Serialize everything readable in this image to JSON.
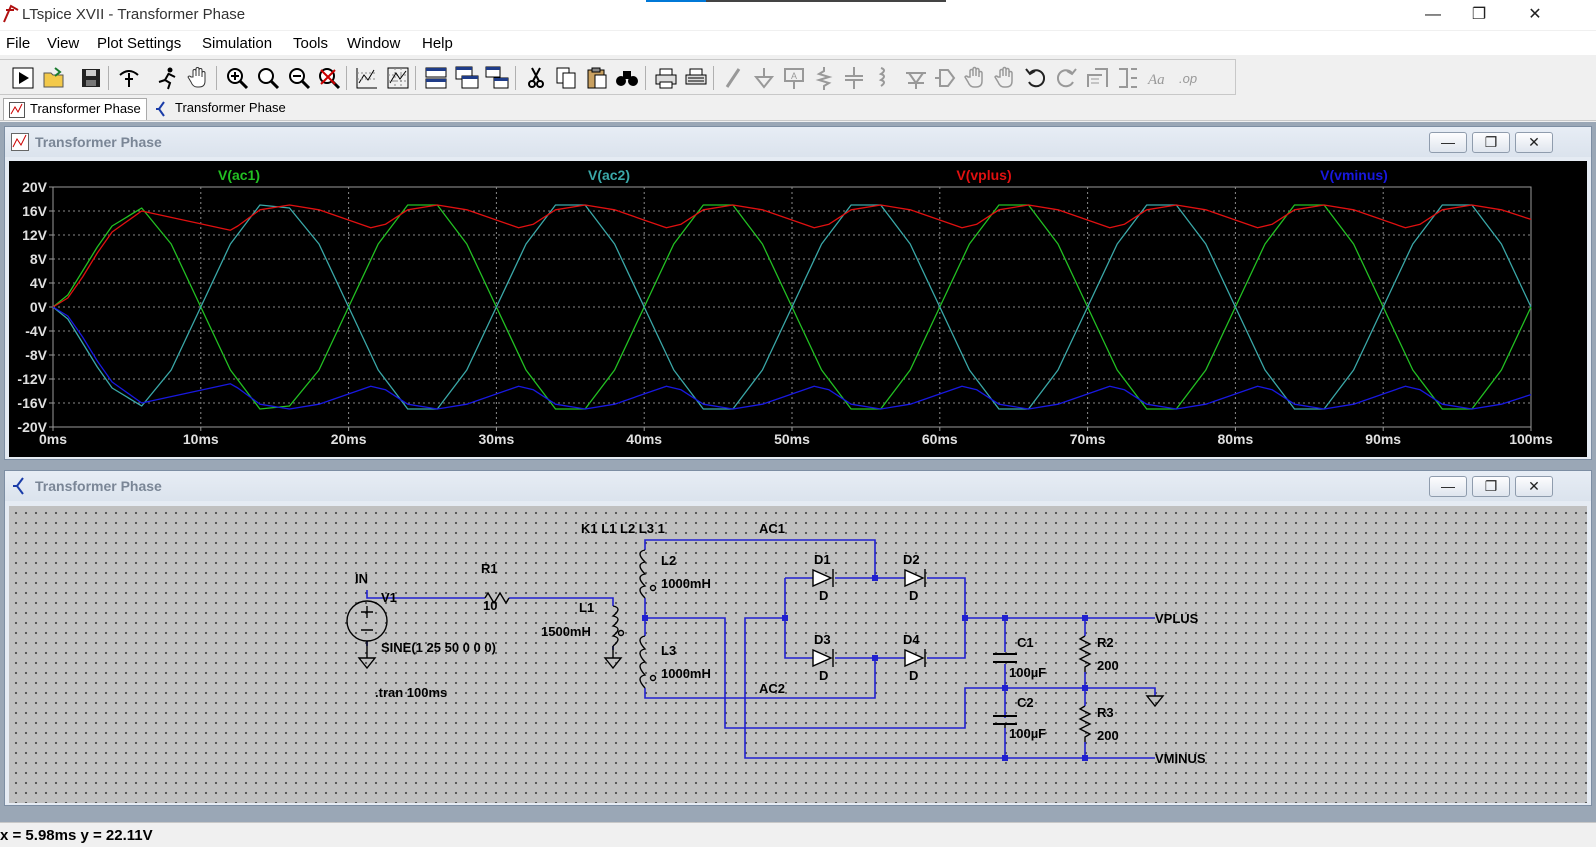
{
  "window": {
    "title": "LTspice XVII - Transformer Phase",
    "controls": {
      "minimize": "—",
      "maximize": "❐",
      "close": "✕"
    }
  },
  "menu": [
    "File",
    "View",
    "Plot Settings",
    "Simulation",
    "Tools",
    "Window",
    "Help"
  ],
  "toolbar_icons": [
    "run-icon",
    "open-icon",
    "save-icon",
    "control-panel-icon",
    "halt-icon",
    "pan-icon",
    "zoom-in-icon",
    "zoom-area-icon",
    "zoom-out-icon",
    "zoom-full-icon",
    "autorange-icon",
    "grid-icon",
    "tile-horizontal-icon",
    "cascade-icon",
    "tile-vertical-icon",
    "cut-icon",
    "copy-icon",
    "paste-icon",
    "find-icon",
    "print-icon",
    "print-preview-icon",
    "wire-icon",
    "ground-icon",
    "label-net-icon",
    "resistor-icon",
    "capacitor-icon",
    "inductor-icon",
    "diode-icon",
    "component-icon",
    "move-icon",
    "drag-icon",
    "undo-icon",
    "redo-icon",
    "rotate-icon",
    "mirror-icon",
    "text-icon",
    "spice-directive-icon"
  ],
  "tabs": [
    {
      "label": "Transformer Phase",
      "icon": "waveform-icon"
    },
    {
      "label": "Transformer Phase",
      "icon": "schematic-icon"
    }
  ],
  "plot_window": {
    "title": "Transformer Phase",
    "buttons": {
      "minimize": "—",
      "maximize": "❐",
      "close": "✕"
    }
  },
  "schematic_window": {
    "title": "Transformer Phase",
    "buttons": {
      "minimize": "—",
      "maximize": "❐",
      "close": "✕"
    }
  },
  "status": "x = 5.98ms    y = 22.11V",
  "colors": {
    "ac1": "#22c022",
    "ac2": "#3aa8a8",
    "vplus": "#e01010",
    "vminus": "#1818e0"
  },
  "chart_data": {
    "type": "line",
    "xlim": [
      0,
      100
    ],
    "ylim": [
      -20,
      20
    ],
    "x_ticks": [
      "0ms",
      "10ms",
      "20ms",
      "30ms",
      "40ms",
      "50ms",
      "60ms",
      "70ms",
      "80ms",
      "90ms",
      "100ms"
    ],
    "y_ticks": [
      "20V",
      "16V",
      "12V",
      "8V",
      "4V",
      "0V",
      "-4V",
      "-8V",
      "-12V",
      "-16V",
      "-20V"
    ],
    "grid": true,
    "series": [
      {
        "name": "V(ac1)",
        "color": "#22c022",
        "x": [
          0,
          1,
          2,
          3,
          4,
          6,
          8,
          10,
          12,
          14,
          16,
          18,
          20,
          22,
          24,
          26,
          28,
          30,
          32,
          34,
          36,
          38,
          40,
          42,
          44,
          46,
          48,
          50,
          52,
          54,
          56,
          58,
          60,
          62,
          64,
          66,
          68,
          70,
          72,
          74,
          76,
          78,
          80,
          82,
          84,
          86,
          88,
          90,
          92,
          94,
          96,
          98,
          100
        ],
        "values": [
          0,
          2,
          6,
          10,
          13.5,
          16.5,
          10.5,
          0,
          -10.5,
          -17,
          -16.5,
          -10.5,
          0,
          10.5,
          17,
          17,
          10.5,
          0,
          -10.5,
          -17,
          -17,
          -10.5,
          0,
          10.5,
          17,
          17,
          10.5,
          0,
          -10.5,
          -17,
          -17,
          -10.5,
          0,
          10.5,
          17,
          17,
          10.5,
          0,
          -10.5,
          -17,
          -17,
          -10.5,
          0,
          10.5,
          17,
          17,
          10.5,
          0,
          -10.5,
          -17,
          -17,
          -10.5,
          0
        ]
      },
      {
        "name": "V(ac2)",
        "color": "#3aa8a8",
        "x": [
          0,
          1,
          2,
          3,
          4,
          6,
          8,
          10,
          12,
          14,
          16,
          18,
          20,
          22,
          24,
          26,
          28,
          30,
          32,
          34,
          36,
          38,
          40,
          42,
          44,
          46,
          48,
          50,
          52,
          54,
          56,
          58,
          60,
          62,
          64,
          66,
          68,
          70,
          72,
          74,
          76,
          78,
          80,
          82,
          84,
          86,
          88,
          90,
          92,
          94,
          96,
          98,
          100
        ],
        "values": [
          0,
          -2,
          -6,
          -10,
          -13.5,
          -16.5,
          -10.5,
          0,
          10.5,
          17,
          16.5,
          10.5,
          0,
          -10.5,
          -17,
          -17,
          -10.5,
          0,
          10.5,
          17,
          17,
          10.5,
          0,
          -10.5,
          -17,
          -17,
          -10.5,
          0,
          10.5,
          17,
          17,
          10.5,
          0,
          -10.5,
          -17,
          -17,
          -10.5,
          0,
          10.5,
          17,
          17,
          10.5,
          0,
          -10.5,
          -17,
          -17,
          -10.5,
          0,
          10.5,
          17,
          17,
          10.5,
          0
        ]
      },
      {
        "name": "V(vplus)",
        "color": "#e01010",
        "x": [
          0,
          1,
          2,
          3,
          4,
          6,
          12,
          12.5,
          14,
          16,
          18,
          21.5,
          22.5,
          24,
          26,
          28,
          31.5,
          32.5,
          34,
          36,
          38,
          41.5,
          42.5,
          44,
          46,
          48,
          51.5,
          52.5,
          54,
          56,
          58,
          61.5,
          62.5,
          64,
          66,
          68,
          71.5,
          72.5,
          74,
          76,
          78,
          81.5,
          82.5,
          84,
          86,
          88,
          91.5,
          92.5,
          94,
          96,
          98,
          100
        ],
        "values": [
          0,
          1.5,
          5,
          9,
          12.5,
          16,
          12.8,
          13.5,
          16.2,
          17,
          16.2,
          13.2,
          13.8,
          16.2,
          17,
          16.2,
          13.2,
          13.8,
          16.2,
          17,
          16.2,
          13.2,
          13.8,
          16.2,
          17,
          16.2,
          13.2,
          13.8,
          16.2,
          17,
          16.2,
          13.2,
          13.8,
          16.2,
          17,
          16.2,
          13.2,
          13.8,
          16.2,
          17,
          16.2,
          13.2,
          13.8,
          16.2,
          17,
          16.2,
          13.2,
          13.8,
          16.2,
          17,
          16.2,
          14.6
        ]
      },
      {
        "name": "V(vminus)",
        "color": "#1818e0",
        "x": [
          0,
          1,
          2,
          3,
          4,
          6,
          12,
          12.5,
          14,
          16,
          18,
          21.5,
          22.5,
          24,
          26,
          28,
          31.5,
          32.5,
          34,
          36,
          38,
          41.5,
          42.5,
          44,
          46,
          48,
          51.5,
          52.5,
          54,
          56,
          58,
          61.5,
          62.5,
          64,
          66,
          68,
          71.5,
          72.5,
          74,
          76,
          78,
          81.5,
          82.5,
          84,
          86,
          88,
          91.5,
          92.5,
          94,
          96,
          98,
          100
        ],
        "values": [
          0,
          -1.5,
          -5,
          -9,
          -12.5,
          -16,
          -12.8,
          -13.5,
          -16.2,
          -17,
          -16.2,
          -13.2,
          -13.8,
          -16.2,
          -17,
          -16.2,
          -13.2,
          -13.8,
          -16.2,
          -17,
          -16.2,
          -13.2,
          -13.8,
          -16.2,
          -17,
          -16.2,
          -13.2,
          -13.8,
          -16.2,
          -17,
          -16.2,
          -13.2,
          -13.8,
          -16.2,
          -17,
          -16.2,
          -13.2,
          -13.8,
          -16.2,
          -17,
          -16.2,
          -13.2,
          -13.8,
          -16.2,
          -17,
          -16.2,
          -13.2,
          -13.8,
          -16.2,
          -17,
          -16.2,
          -14.6
        ]
      }
    ]
  },
  "schematic": {
    "labels": {
      "in": "IN",
      "v1": "V1",
      "v1_value": "SINE(1 25 50 0 0 0)",
      "tran": ".tran 100ms",
      "r1": "R1",
      "r1_value": "10",
      "l1": "L1",
      "l1_value": "1500mH",
      "kdir": "K1 L1 L2 L3 1",
      "l2": "L2",
      "l2_value": "1000mH",
      "l3": "L3",
      "l3_value": "1000mH",
      "ac1": "AC1",
      "ac2": "AC2",
      "d1": "D1",
      "d2": "D2",
      "d3": "D3",
      "d4": "D4",
      "d_model": "D",
      "c1": "C1",
      "c1_value": "100µF",
      "c2": "C2",
      "c2_value": "100µF",
      "r2": "R2",
      "r2_value": "200",
      "r3": "R3",
      "r3_value": "200",
      "vplus": "VPLUS",
      "vminus": "VMINUS"
    }
  }
}
